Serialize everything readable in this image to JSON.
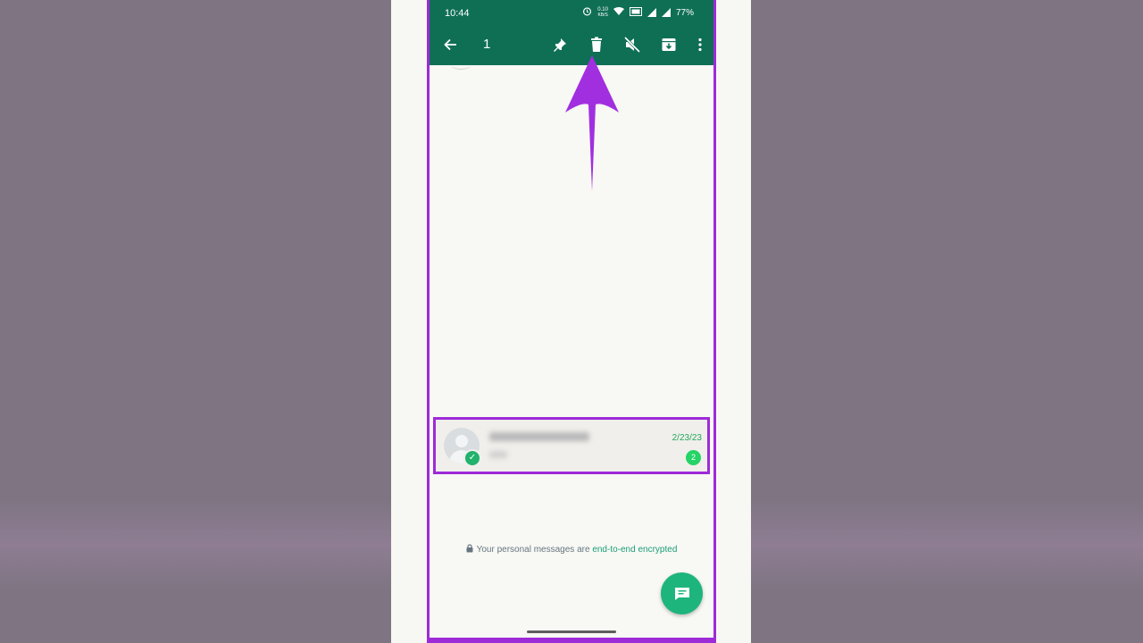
{
  "status_bar": {
    "time": "10:44",
    "speed_value": "0.10",
    "speed_unit": "KB/S",
    "battery": "77%"
  },
  "app_bar": {
    "selected_count": "1",
    "actions": [
      "pin-icon",
      "delete-icon",
      "mute-icon",
      "archive-icon",
      "more-options-icon"
    ]
  },
  "chat_list": [
    {
      "date": "2/23/23",
      "unread_count": "2",
      "selected": true
    }
  ],
  "footer": {
    "encryption_text": "Your personal messages are ",
    "encryption_link": "end-to-end encrypted"
  },
  "colors": {
    "app_bar": "#0f6f55",
    "highlight": "#9d2bd8",
    "fab": "#1eb57c",
    "date": "#24a65c"
  }
}
